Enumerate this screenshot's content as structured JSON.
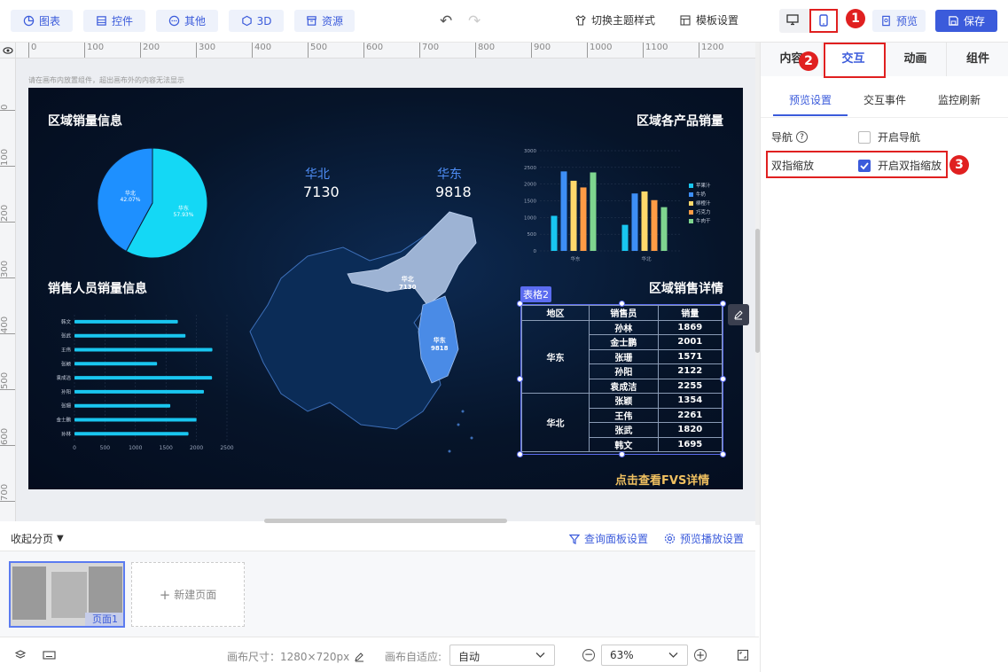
{
  "toolbar": {
    "chart": "图表",
    "widget": "控件",
    "other": "其他",
    "three_d": "3D",
    "resource": "资源",
    "theme": "切换主题样式",
    "template": "模板设置",
    "preview": "预览",
    "save": "保存"
  },
  "badges": {
    "one": "1",
    "two": "2",
    "three": "3"
  },
  "ruler": {
    "h": [
      "0",
      "100",
      "200",
      "300",
      "400",
      "500",
      "600",
      "700",
      "800",
      "900",
      "1000",
      "1100",
      "1200"
    ],
    "v": [
      "0",
      "100",
      "200",
      "300",
      "400",
      "500",
      "600",
      "700"
    ]
  },
  "canvas": {
    "hint": "请在画布内放置组件，超出画布外的内容无法显示",
    "title_region_sales": "区域销量信息",
    "title_product_sales": "区域各产品销量",
    "title_person_sales": "销售人员销量信息",
    "title_region_detail": "区域销售详情",
    "link_text": "点击查看FVS详情",
    "table_badge": "表格2",
    "map": {
      "north_label": "华北",
      "north_value": "7130",
      "east_label": "华东",
      "east_value": "9818"
    }
  },
  "pie": {
    "type": "pie",
    "slices": [
      {
        "name": "华北",
        "percent": "42.07%",
        "value": 42.07,
        "color": "#1e90ff"
      },
      {
        "name": "华东",
        "percent": "57.93%",
        "value": 57.93,
        "color": "#14d8f5"
      }
    ]
  },
  "chart_data": [
    {
      "type": "bar",
      "title": "区域各产品销量",
      "categories": [
        "华东",
        "华北"
      ],
      "ylim": [
        0,
        3000
      ],
      "yticks": [
        "0",
        "500",
        "1000",
        "1500",
        "2000",
        "2500",
        "3000"
      ],
      "legend": "right",
      "series": [
        {
          "name": "苹果汁",
          "color": "#19c6f0",
          "values": [
            1050,
            780
          ]
        },
        {
          "name": "牛奶",
          "color": "#3d8ef5",
          "values": [
            2380,
            1720
          ]
        },
        {
          "name": "柳橙汁",
          "color": "#ffd86b",
          "values": [
            2100,
            1780
          ]
        },
        {
          "name": "巧克力",
          "color": "#ff9b45",
          "values": [
            1900,
            1520
          ]
        },
        {
          "name": "牛肉干",
          "color": "#7ed58f",
          "values": [
            2350,
            1310
          ]
        }
      ]
    },
    {
      "type": "bar",
      "title": "销售人员销量信息",
      "orientation": "horizontal",
      "categories": [
        "韩文",
        "张武",
        "王伟",
        "张颖",
        "袁成洁",
        "孙阳",
        "张珊",
        "金士鹏",
        "孙林"
      ],
      "values": [
        1695,
        1820,
        2261,
        1354,
        2255,
        2122,
        1571,
        2001,
        1869
      ],
      "xlim": [
        0,
        2500
      ],
      "xticks": [
        "0",
        "500",
        "1000",
        "1500",
        "2000",
        "2500"
      ],
      "color": "#19c6f0"
    }
  ],
  "detail_table": {
    "headers": [
      "地区",
      "销售员",
      "销量"
    ],
    "regions": [
      "华东",
      "华北"
    ],
    "rows": [
      [
        "孙林",
        "1869"
      ],
      [
        "金士鹏",
        "2001"
      ],
      [
        "张珊",
        "1571"
      ],
      [
        "孙阳",
        "2122"
      ],
      [
        "袁成洁",
        "2255"
      ],
      [
        "张颖",
        "1354"
      ],
      [
        "王伟",
        "2261"
      ],
      [
        "张武",
        "1820"
      ],
      [
        "韩文",
        "1695"
      ]
    ]
  },
  "right_panel": {
    "tabs": [
      "内容",
      "交互",
      "动画",
      "组件"
    ],
    "subtabs": [
      "预览设置",
      "交互事件",
      "监控刷新"
    ],
    "nav_label": "导航",
    "nav_option": "开启导航",
    "pinch_label": "双指缩放",
    "pinch_option": "开启双指缩放"
  },
  "pages": {
    "collapse": "收起分页",
    "query_panel": "查询面板设置",
    "preview_play": "预览播放设置",
    "page1": "页面1",
    "new_page": "新建页面"
  },
  "status": {
    "canvas_size_label": "画布尺寸：1280×720px",
    "adapt_label": "画布自适应:",
    "adapt_value": "自动",
    "zoom": "63%"
  }
}
